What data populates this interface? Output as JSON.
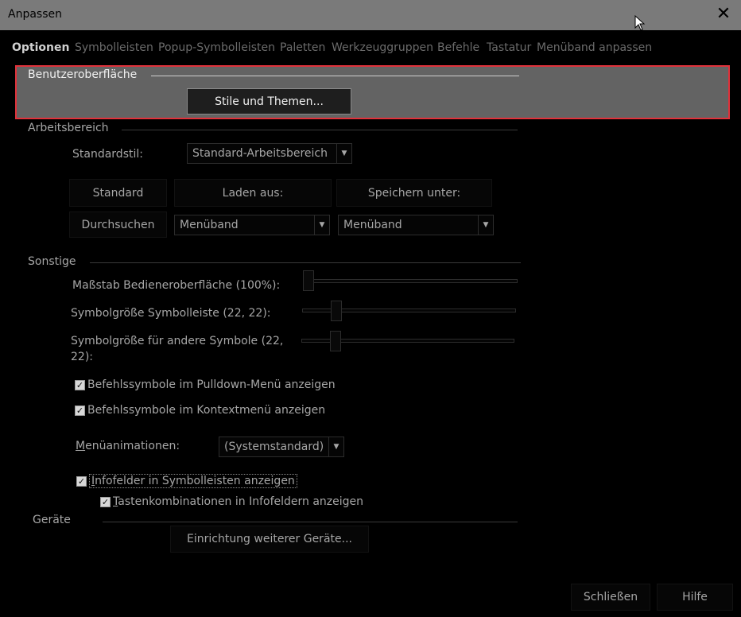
{
  "window": {
    "title": "Anpassen",
    "close_symbol": "✕"
  },
  "tabs": [
    {
      "label": "Optionen",
      "active": true
    },
    {
      "label": "Symbolleisten"
    },
    {
      "label": "Popup-Symbolleisten"
    },
    {
      "label": "Paletten"
    },
    {
      "label": "Werkzeuggruppen"
    },
    {
      "label": "Befehle"
    },
    {
      "label": "Tastatur"
    },
    {
      "label": "Menüband anpassen"
    }
  ],
  "ui_section": {
    "label": "Benutzeroberfläche",
    "button": "Stile und Themen..."
  },
  "workspace": {
    "label": "Arbeitsbereich",
    "default_style_label": "Standardstil:",
    "default_style_value": "Standard-Arbeitsbereich",
    "col_standard": "Standard",
    "col_load": "Laden aus:",
    "col_save": "Speichern unter:",
    "browse_button": "Durchsuchen",
    "load_value": "Menüband",
    "save_value": "Menüband"
  },
  "misc": {
    "label": "Sonstige",
    "scale_label": "Maßstab Bedieneroberfläche (100%):",
    "scale_level": 0,
    "toolbar_icon_label": "Symbolgröße Symbolleiste (22, 22):",
    "toolbar_icon_level": 0.14,
    "other_icon_label_1": "Symbolgröße für andere Symbole (22,",
    "other_icon_label_2": "22):",
    "other_icon_level": 0.14,
    "cb_pulldown": "Befehlssymbole im Pulldown-Menü anzeigen",
    "cb_context": "Befehlssymbole im Kontextmenü anzeigen",
    "anim_label_first": "M",
    "anim_label_rest": "enüanimationen:",
    "anim_value": "(Systemstandard)",
    "cb_infofields_first": "I",
    "cb_infofields_rest": "nfofelder in Symbolleisten anzeigen",
    "cb_shortcuts_first": "T",
    "cb_shortcuts_rest": "astenkombinationen in Infofeldern anzeigen"
  },
  "devices": {
    "label": "Geräte",
    "button": "Einrichtung weiterer Geräte..."
  },
  "footer": {
    "close": "Schließen",
    "help": "Hilfe"
  },
  "colors": {
    "accent_outline": "#e0313a",
    "title_bar": "#7a7a7a",
    "background": "#000000"
  }
}
